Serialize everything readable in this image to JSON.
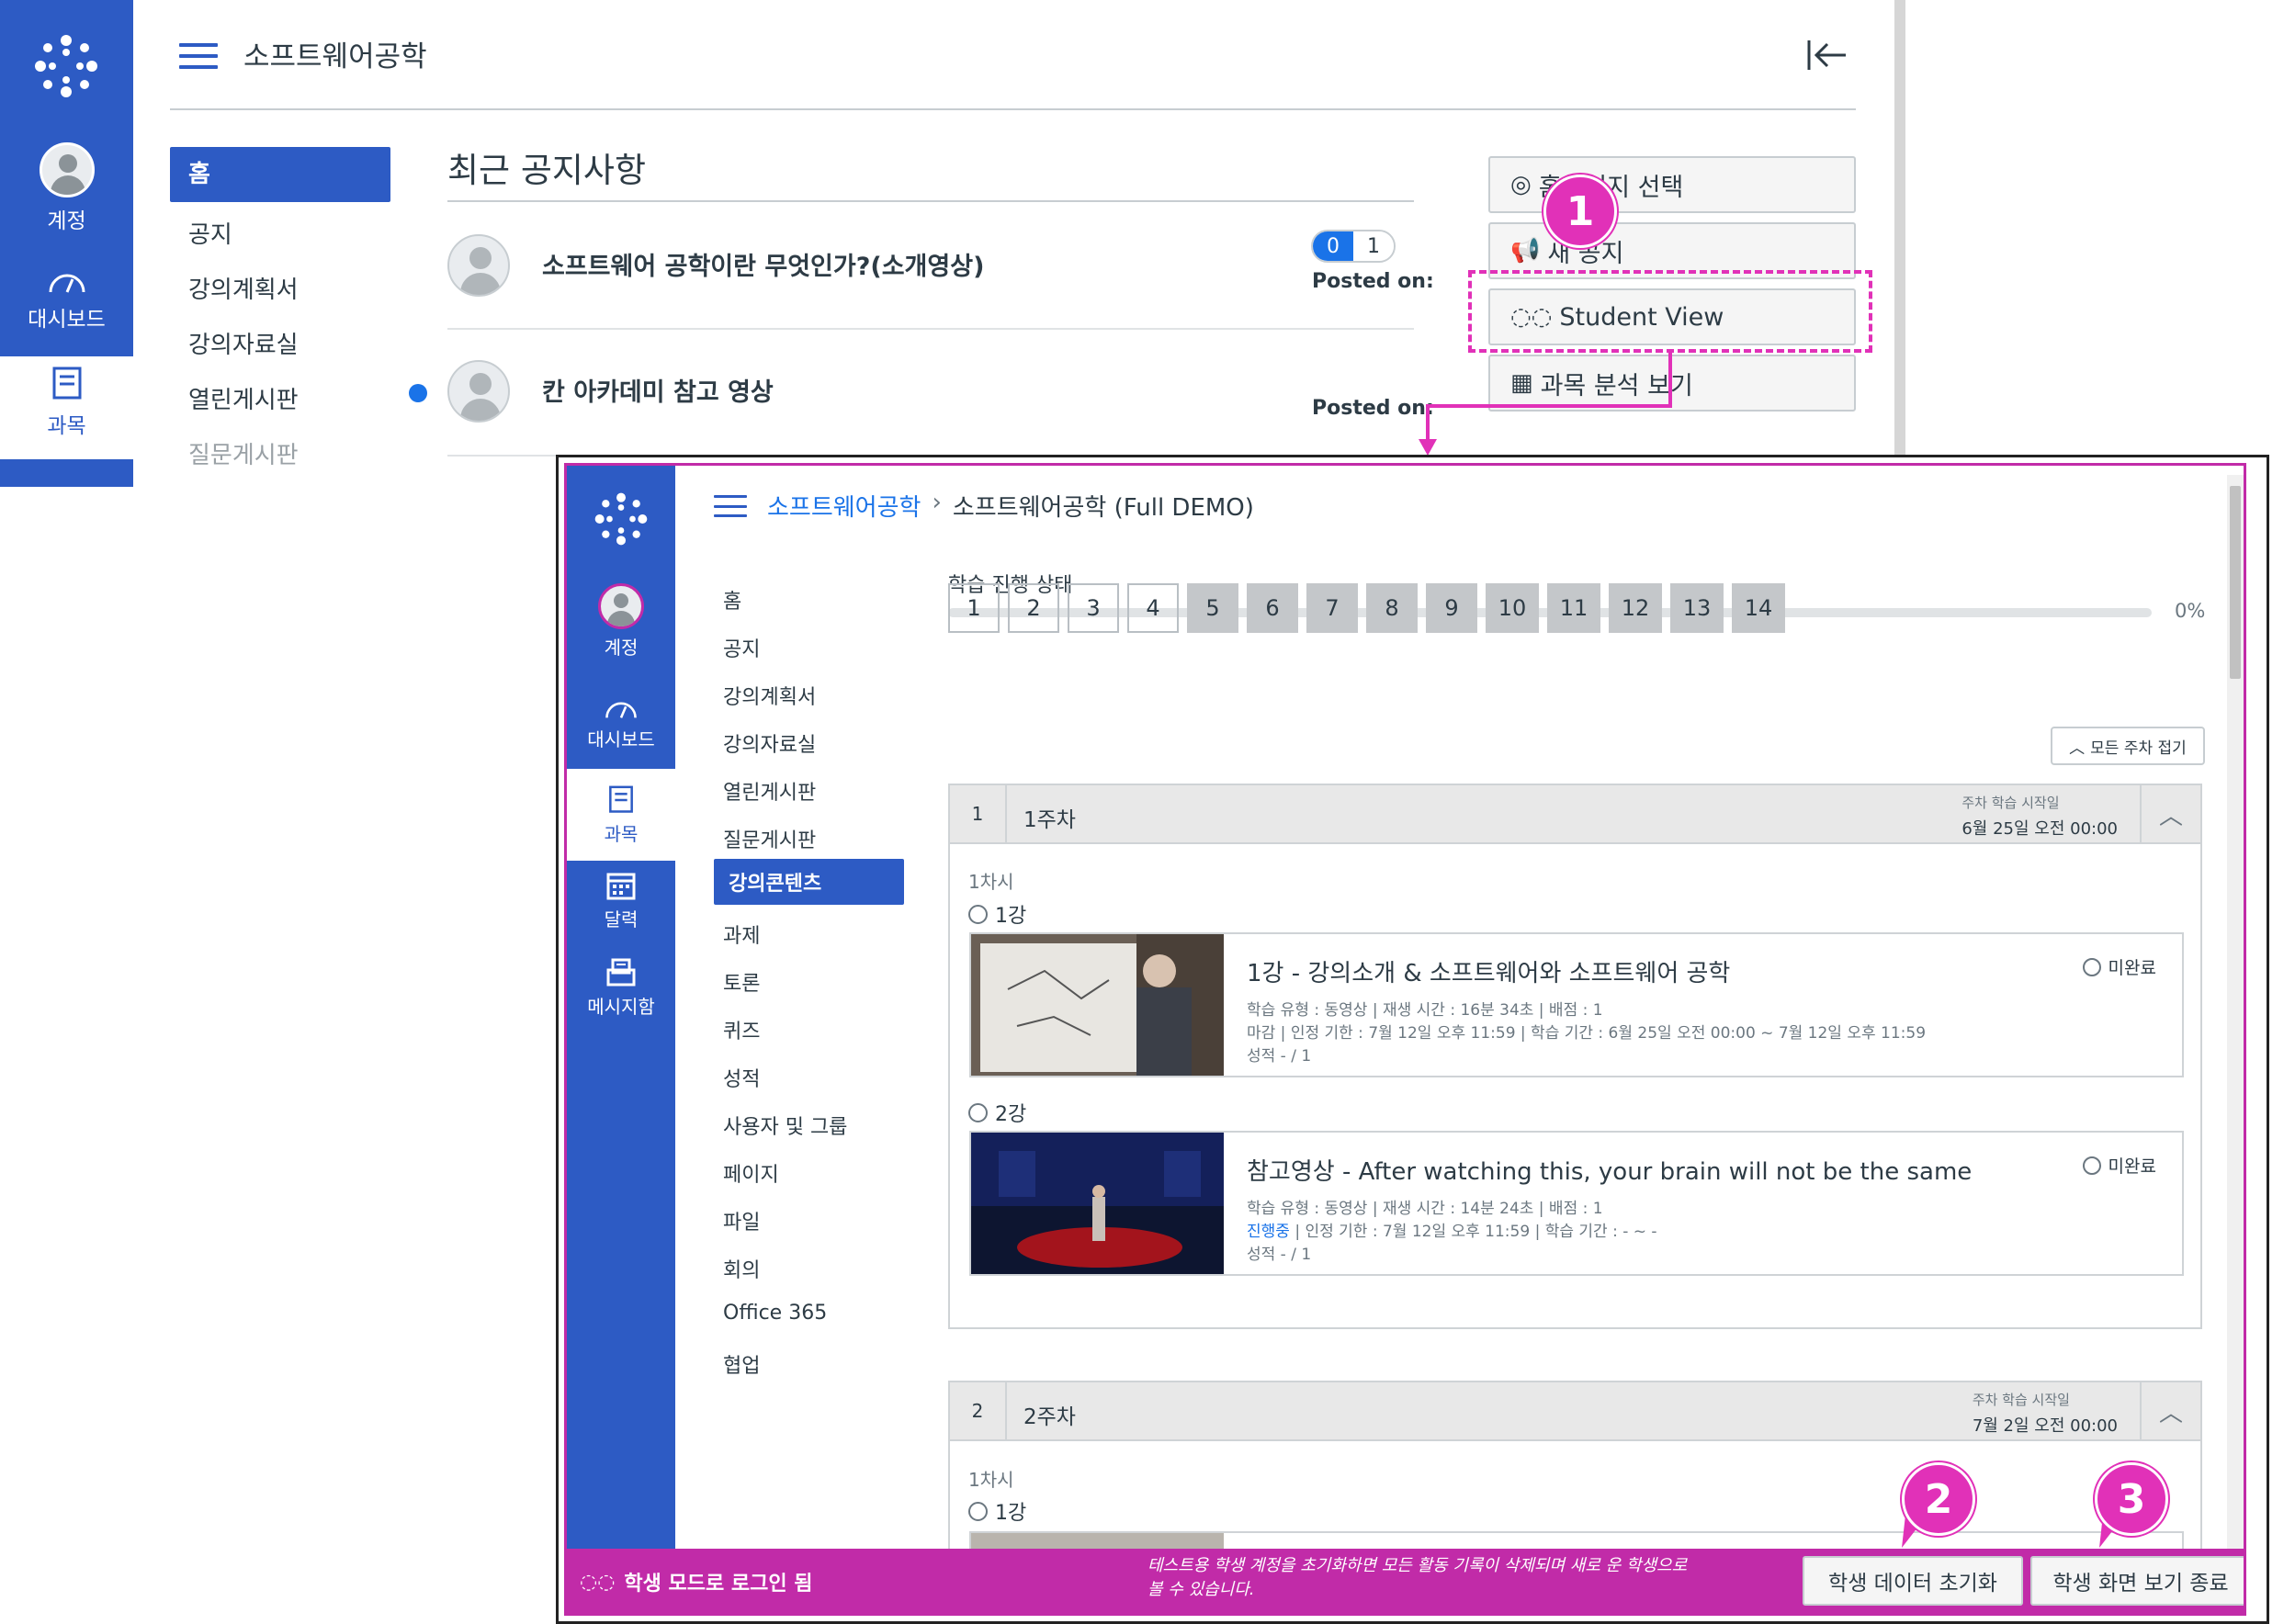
{
  "instructor_view": {
    "course_title": "소프트웨어공학",
    "global_nav": [
      {
        "label": "계정",
        "icon": "account-icon"
      },
      {
        "label": "대시보드",
        "icon": "dashboard-icon"
      },
      {
        "label": "과목",
        "icon": "courses-icon"
      }
    ],
    "course_nav": [
      "홈",
      "공지",
      "강의계획서",
      "강의자료실",
      "열린게시판",
      "질문게시판"
    ],
    "section_title": "최근 공지사항",
    "announcements": [
      {
        "title": "소프트웨어 공학이란 무엇인가?(소개영상)",
        "unread": "0",
        "total": "1",
        "posted": "Posted on:"
      },
      {
        "title": "칸 아카데미 참고 영상",
        "posted": "Posted on:"
      }
    ],
    "side_buttons": [
      "홈페이지 선택",
      "새 공지",
      "Student View",
      "과목 분석 보기"
    ]
  },
  "student_view": {
    "breadcrumb": {
      "course": "소프트웨어공학",
      "separator": "›",
      "current": "소프트웨어공학 (Full DEMO)"
    },
    "global_nav": [
      {
        "label": "계정"
      },
      {
        "label": "대시보드"
      },
      {
        "label": "과목"
      },
      {
        "label": "달력"
      },
      {
        "label": "메시지함"
      }
    ],
    "course_nav": [
      "홈",
      "공지",
      "강의계획서",
      "강의자료실",
      "열린게시판",
      "질문게시판",
      "강의콘텐츠",
      "과제",
      "토론",
      "퀴즈",
      "성적",
      "사용자 및 그룹",
      "페이지",
      "파일",
      "회의",
      "Office 365",
      "협업"
    ],
    "progress": {
      "label": "학습 진행 상태",
      "value": 0,
      "percent_text": "0%"
    },
    "pages": [
      "1",
      "2",
      "3",
      "4",
      "5",
      "6",
      "7",
      "8",
      "9",
      "10",
      "11",
      "12",
      "13",
      "14"
    ],
    "collapse_all": "모든 주차 접기",
    "weeks": [
      {
        "num": "1",
        "title": "1주차",
        "start_label": "주차 학습 시작일",
        "start_date": "6월 25일 오전 00:00",
        "session": "1차시",
        "lessons": [
          {
            "gang": "1강",
            "title": "1강 - 강의소개 & 소프트웨어와 소프트웨어 공학",
            "meta1": "학습 유형 : 동영상 | 재생 시간 : 16분 34초 | 배점 : 1",
            "meta2": "마감 | 인정 기한 : 7월 12일 오후 11:59 | 학습 기간 : 6월 25일 오전 00:00 ~ 7월 12일 오후 11:59",
            "meta3": "성적 - / 1",
            "status": "미완료"
          },
          {
            "gang": "2강",
            "title": "참고영상 - After watching this, your brain will not be the same",
            "meta1": "학습 유형 : 동영상 | 재생 시간 : 14분 24초 | 배점 : 1",
            "meta2_state": "진행중",
            "meta2": " | 인정 기한 : 7월 12일 오후 11:59 | 학습 기간 : - ~ -",
            "meta3": "성적 - / 1",
            "status": "미완료"
          }
        ]
      },
      {
        "num": "2",
        "title": "2주차",
        "start_label": "주차 학습 시작일",
        "start_date": "7월 2일 오전 00:00",
        "session": "1차시",
        "lessons": [
          {
            "gang": "1강"
          }
        ]
      }
    ],
    "student_bar": {
      "label": "학생 모드로 로그인 됨",
      "message": "테스트용 학생 계정을 초기화하면 모든 활동 기록이 삭제되며 새로 운 학생으로 볼 수 있습니다.",
      "reset_button": "학생 데이터 초기화",
      "exit_button": "학생 화면 보기 종료"
    }
  },
  "callouts": [
    "1",
    "2",
    "3"
  ],
  "colors": {
    "canvas_blue": "#2d5bc4",
    "student_magenta": "#c12ba8",
    "callout_pink": "#e131b8",
    "unread_blue": "#1a73e8"
  }
}
